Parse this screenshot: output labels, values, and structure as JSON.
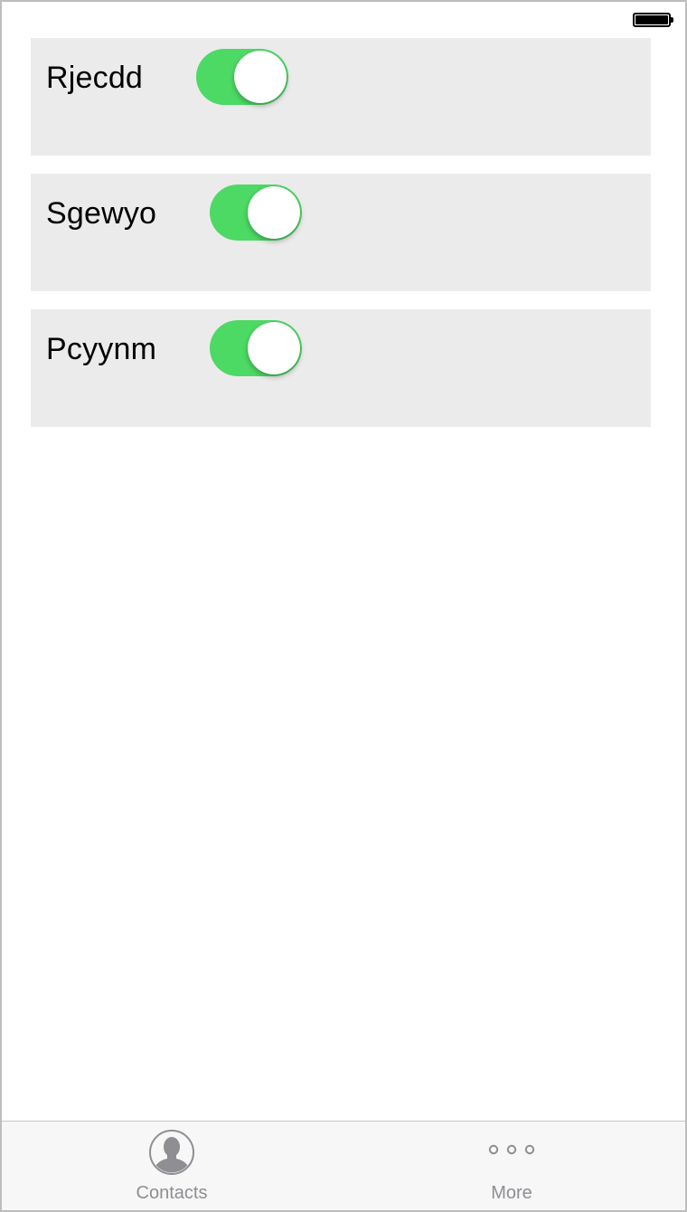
{
  "status_bar": {
    "battery_icon": "battery-full-icon"
  },
  "rows": [
    {
      "label": "Rjecdd",
      "toggle_on": true
    },
    {
      "label": "Sgewyo",
      "toggle_on": true
    },
    {
      "label": "Pcyynm",
      "toggle_on": true
    }
  ],
  "tab_bar": {
    "tabs": [
      {
        "label": "Contacts",
        "icon": "contact-person-icon"
      },
      {
        "label": "More",
        "icon": "more-dots-icon"
      }
    ]
  },
  "colors": {
    "toggle_on": "#4cd964",
    "row_background": "#ebebeb",
    "tab_inactive": "#8e8e93"
  }
}
